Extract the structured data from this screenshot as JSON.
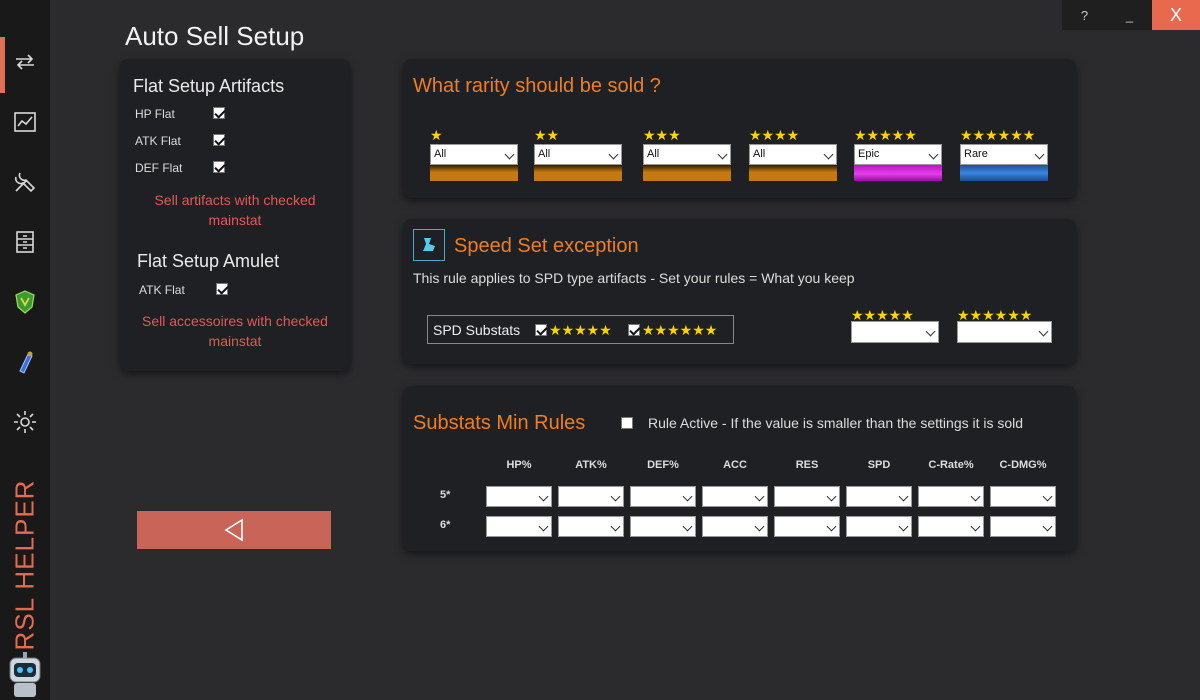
{
  "app": {
    "brand": "RSL HELPER"
  },
  "window": {
    "help": "?",
    "minimize": "_",
    "close": "X"
  },
  "page_title": "Auto Sell Setup",
  "sidebar": {
    "items": [
      {
        "icon": "swap-arrows-icon",
        "active": true
      },
      {
        "icon": "chart-icon",
        "active": false
      },
      {
        "icon": "tools-icon",
        "active": false
      },
      {
        "icon": "archive-icon",
        "active": false
      },
      {
        "icon": "shield-icon",
        "active": false
      },
      {
        "icon": "potion-icon",
        "active": false
      },
      {
        "icon": "gear-icon",
        "active": false
      }
    ]
  },
  "flat": {
    "artifacts_title": "Flat Setup Artifacts",
    "artifacts": [
      {
        "label": "HP Flat",
        "checked": true
      },
      {
        "label": "ATK Flat",
        "checked": true
      },
      {
        "label": "DEF Flat",
        "checked": true
      }
    ],
    "artifacts_note_1": "Sell artifacts with checked",
    "artifacts_note_2": "mainstat",
    "amulet_title": "Flat Setup Amulet",
    "amulet": [
      {
        "label": "ATK Flat",
        "checked": true
      }
    ],
    "amulet_note_1": "Sell accessoires with checked",
    "amulet_note_2": "mainstat"
  },
  "rarity": {
    "title": "What rarity should be sold ?",
    "columns": [
      {
        "stars": "★",
        "value": "All",
        "bar": "#c47a10"
      },
      {
        "stars": "★★",
        "value": "All",
        "bar": "#c47a10"
      },
      {
        "stars": "★★★",
        "value": "All",
        "bar": "#c47a10"
      },
      {
        "stars": "★★★★",
        "value": "All",
        "bar": "#c47a10"
      },
      {
        "stars": "★★★★★",
        "value": "Epic",
        "bar": "#c010c8"
      },
      {
        "stars": "★★★★★★",
        "value": "Rare",
        "bar": "#2f6fc2"
      }
    ]
  },
  "speed": {
    "title": "Speed Set exception",
    "description": "This rule applies to SPD type artifacts - Set your rules = What you keep",
    "substats_label": "SPD Substats",
    "check5_stars": "★★★★★",
    "check6_stars": "★★★★★★",
    "sel5_stars": "★★★★★",
    "sel6_stars": "★★★★★★",
    "sel5_value": "",
    "sel6_value": ""
  },
  "substats": {
    "title": "Substats Min Rules",
    "rule_text": "Rule Active - If the value is smaller than the settings it is sold",
    "rule_active": false,
    "columns": [
      "HP%",
      "ATK%",
      "DEF%",
      "ACC",
      "RES",
      "SPD",
      "C-Rate%",
      "C-DMG%"
    ],
    "rows": [
      "5*",
      "6*"
    ]
  },
  "colors": {
    "accent": "#f07d22",
    "note": "#e05a55",
    "back_button": "#c96558",
    "close": "#e8694d"
  }
}
